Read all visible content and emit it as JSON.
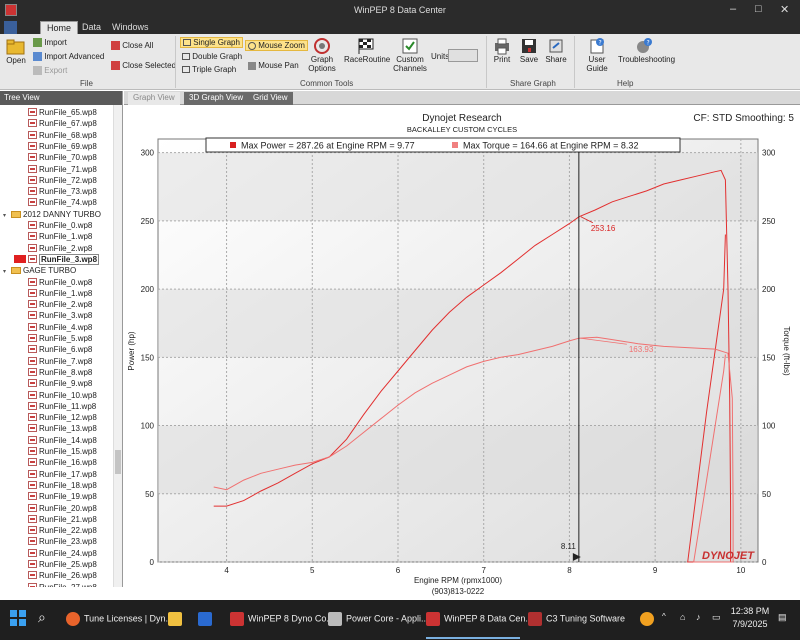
{
  "window": {
    "title": "WinPEP 8 Data Center",
    "controls": [
      "–",
      "□",
      "✕"
    ]
  },
  "menu": {
    "tabs": [
      "Home",
      "Data",
      "Windows"
    ],
    "active": "Home"
  },
  "ribbon": {
    "file": {
      "open": "Open",
      "import": "Import",
      "import_advanced": "Import Advanced",
      "export": "Export",
      "close_all": "Close All",
      "close_selected": "Close Selected",
      "group": "File"
    },
    "common": {
      "single_graph": "Single Graph",
      "double_graph": "Double Graph",
      "triple_graph": "Triple Graph",
      "mouse_zoom": "Mouse Zoom",
      "mouse_pan": "Mouse Pan",
      "graph_options": "Graph Options",
      "race_routine": "RaceRoutine",
      "custom_channels": "Custom Channels",
      "units": "Units",
      "group": "Common Tools"
    },
    "share": {
      "print": "Print",
      "save": "Save",
      "share": "Share",
      "group": "Share Graph"
    },
    "help": {
      "user_guide": "User Guide",
      "troubleshooting": "Troubleshooting",
      "group": "Help"
    }
  },
  "tree": {
    "title": "Tree View",
    "items": [
      {
        "label": "RunFile_65.wp8",
        "kind": "file"
      },
      {
        "label": "RunFile_67.wp8",
        "kind": "file"
      },
      {
        "label": "RunFile_68.wp8",
        "kind": "file"
      },
      {
        "label": "RunFile_69.wp8",
        "kind": "file"
      },
      {
        "label": "RunFile_70.wp8",
        "kind": "file"
      },
      {
        "label": "RunFile_71.wp8",
        "kind": "file"
      },
      {
        "label": "RunFile_72.wp8",
        "kind": "file"
      },
      {
        "label": "RunFile_73.wp8",
        "kind": "file"
      },
      {
        "label": "RunFile_74.wp8",
        "kind": "file"
      },
      {
        "label": "2012 DANNY TURBO",
        "kind": "folder"
      },
      {
        "label": "RunFile_0.wp8",
        "kind": "file"
      },
      {
        "label": "RunFile_1.wp8",
        "kind": "file"
      },
      {
        "label": "RunFile_2.wp8",
        "kind": "file"
      },
      {
        "label": "RunFile_3.wp8",
        "kind": "selected"
      },
      {
        "label": "GAGE TURBO",
        "kind": "folder"
      },
      {
        "label": "RunFile_0.wp8",
        "kind": "file"
      },
      {
        "label": "RunFile_1.wp8",
        "kind": "file"
      },
      {
        "label": "RunFile_2.wp8",
        "kind": "file"
      },
      {
        "label": "RunFile_3.wp8",
        "kind": "file"
      },
      {
        "label": "RunFile_4.wp8",
        "kind": "file"
      },
      {
        "label": "RunFile_5.wp8",
        "kind": "file"
      },
      {
        "label": "RunFile_6.wp8",
        "kind": "file"
      },
      {
        "label": "RunFile_7.wp8",
        "kind": "file"
      },
      {
        "label": "RunFile_8.wp8",
        "kind": "file"
      },
      {
        "label": "RunFile_9.wp8",
        "kind": "file"
      },
      {
        "label": "RunFile_10.wp8",
        "kind": "file"
      },
      {
        "label": "RunFile_11.wp8",
        "kind": "file"
      },
      {
        "label": "RunFile_12.wp8",
        "kind": "file"
      },
      {
        "label": "RunFile_13.wp8",
        "kind": "file"
      },
      {
        "label": "RunFile_14.wp8",
        "kind": "file"
      },
      {
        "label": "RunFile_15.wp8",
        "kind": "file"
      },
      {
        "label": "RunFile_16.wp8",
        "kind": "file"
      },
      {
        "label": "RunFile_17.wp8",
        "kind": "file"
      },
      {
        "label": "RunFile_18.wp8",
        "kind": "file"
      },
      {
        "label": "RunFile_19.wp8",
        "kind": "file"
      },
      {
        "label": "RunFile_20.wp8",
        "kind": "file"
      },
      {
        "label": "RunFile_21.wp8",
        "kind": "file"
      },
      {
        "label": "RunFile_22.wp8",
        "kind": "file"
      },
      {
        "label": "RunFile_23.wp8",
        "kind": "file"
      },
      {
        "label": "RunFile_24.wp8",
        "kind": "file"
      },
      {
        "label": "RunFile_25.wp8",
        "kind": "file"
      },
      {
        "label": "RunFile_26.wp8",
        "kind": "file"
      },
      {
        "label": "RunFile_27.wp8",
        "kind": "file"
      }
    ]
  },
  "tabs": [
    "Graph View",
    "3D Graph View",
    "Grid View"
  ],
  "graph": {
    "company": "Dynojet Research",
    "subtitle": "BACKALLEY CUSTOM CYCLES",
    "cf": "CF: STD Smoothing: 5",
    "legend_power": "Max Power = 287.26 at Engine RPM = 9.77",
    "legend_torque": "Max Torque = 164.66 at Engine RPM = 8.32",
    "phone": "(903)813-0222",
    "brand": "DYNOJET",
    "cursor_label": "8.11",
    "power_readout": "253.16",
    "torque_readout": "163.93"
  },
  "chart_data": {
    "type": "line",
    "xlabel": "Engine RPM (rpmx1000)",
    "ylabel": "Power (hp)",
    "y2label": "Torque (ft-lbs)",
    "xlim": [
      3.2,
      10.2
    ],
    "ylim": [
      0,
      310
    ],
    "x_ticks": [
      4,
      5,
      6,
      7,
      8,
      9,
      10
    ],
    "y_ticks": [
      0,
      50,
      100,
      150,
      200,
      250,
      300
    ],
    "cursor_x": 8.11,
    "series": [
      {
        "color": "#e23030",
        "points": [
          [
            3.85,
            41
          ],
          [
            4.0,
            41
          ],
          [
            4.2,
            45
          ],
          [
            4.4,
            52
          ],
          [
            4.6,
            58
          ],
          [
            4.8,
            65
          ],
          [
            5.0,
            72
          ],
          [
            5.2,
            77
          ],
          [
            5.4,
            90
          ],
          [
            5.6,
            108
          ],
          [
            5.8,
            125
          ],
          [
            6.0,
            140
          ],
          [
            6.2,
            155
          ],
          [
            6.4,
            170
          ],
          [
            6.6,
            183
          ],
          [
            6.8,
            194
          ],
          [
            7.0,
            203
          ],
          [
            7.2,
            212
          ],
          [
            7.4,
            222
          ],
          [
            7.6,
            232
          ],
          [
            7.8,
            240
          ],
          [
            8.0,
            248
          ],
          [
            8.11,
            253
          ],
          [
            8.3,
            258
          ],
          [
            8.5,
            264
          ],
          [
            8.7,
            268
          ],
          [
            8.9,
            272
          ],
          [
            9.1,
            277
          ],
          [
            9.3,
            280
          ],
          [
            9.5,
            283
          ],
          [
            9.7,
            286
          ],
          [
            9.77,
            287
          ],
          [
            9.82,
            280
          ],
          [
            9.85,
            200
          ],
          [
            9.87,
            120
          ],
          [
            9.88,
            40
          ],
          [
            9.88,
            0
          ],
          [
            9.38,
            0
          ],
          [
            9.6,
            110
          ],
          [
            9.8,
            200
          ],
          [
            9.82,
            240
          ]
        ]
      },
      {
        "color": "#f07070",
        "points": [
          [
            3.85,
            55
          ],
          [
            4.0,
            53
          ],
          [
            4.2,
            60
          ],
          [
            4.4,
            65
          ],
          [
            4.6,
            68
          ],
          [
            4.8,
            71
          ],
          [
            5.0,
            73
          ],
          [
            5.2,
            77
          ],
          [
            5.4,
            85
          ],
          [
            5.6,
            95
          ],
          [
            5.8,
            105
          ],
          [
            6.0,
            115
          ],
          [
            6.2,
            124
          ],
          [
            6.4,
            131
          ],
          [
            6.6,
            137
          ],
          [
            6.8,
            143
          ],
          [
            7.0,
            147
          ],
          [
            7.2,
            150
          ],
          [
            7.4,
            152
          ],
          [
            7.6,
            155
          ],
          [
            7.8,
            158
          ],
          [
            8.0,
            162
          ],
          [
            8.11,
            164
          ],
          [
            8.32,
            164.66
          ],
          [
            8.5,
            163
          ],
          [
            8.8,
            160
          ],
          [
            9.1,
            158
          ],
          [
            9.4,
            157
          ],
          [
            9.7,
            156
          ],
          [
            9.85,
            153
          ],
          [
            9.9,
            120
          ],
          [
            9.91,
            40
          ],
          [
            9.91,
            0
          ],
          [
            9.45,
            0
          ],
          [
            9.65,
            80
          ],
          [
            9.8,
            140
          ],
          [
            9.82,
            152
          ]
        ]
      }
    ]
  },
  "taskbar": {
    "items": [
      "Tune Licenses | Dyn...",
      "WinPEP 8 Dyno Co...",
      "Power Core - Appli...",
      "WinPEP 8 Data Cen...",
      "C3 Tuning Software"
    ],
    "time": "12:38 PM",
    "date": "7/9/2025"
  }
}
